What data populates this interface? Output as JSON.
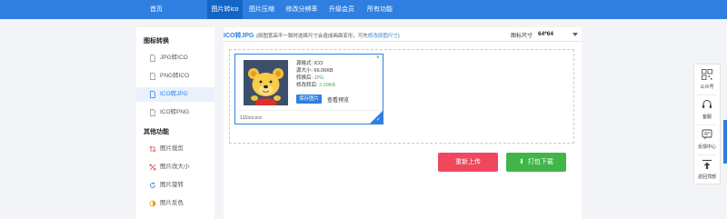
{
  "nav": {
    "items": [
      {
        "label": "首页",
        "active": false
      },
      {
        "label": "图片转ico",
        "active": true
      },
      {
        "label": "图片压缩",
        "active": false
      },
      {
        "label": "修改分辨率",
        "active": false
      },
      {
        "label": "升级会员",
        "active": false
      },
      {
        "label": "所有功能",
        "active": false
      }
    ]
  },
  "sidebar": {
    "group1": "图标转换",
    "items1": [
      {
        "label": "JPG转ICO",
        "icon": "file-icon"
      },
      {
        "label": "PNG转ICO",
        "icon": "file-icon"
      },
      {
        "label": "ICO转JPG",
        "icon": "file-icon"
      },
      {
        "label": "ICO转PNG",
        "icon": "file-icon"
      }
    ],
    "group2": "其他功能",
    "items2": [
      {
        "label": "图片裁剪",
        "icon": "crop-icon"
      },
      {
        "label": "图片改大小",
        "icon": "resize-icon"
      },
      {
        "label": "图片旋转",
        "icon": "rotate-icon"
      },
      {
        "label": "图片反色",
        "icon": "invert-icon"
      }
    ]
  },
  "main": {
    "title": "ICO转JPG",
    "note_prefix": "(原图宽高不一致时选择尺寸会造成画面变形，可先",
    "note_link": "修改原图尺寸",
    "note_suffix": ")",
    "size_label": "图标尺寸",
    "size_value": "64*64"
  },
  "card": {
    "format_label": "源格式: ICO",
    "size_label": "源大小: 66.06KB",
    "converted_prefix": "转换后: ",
    "converted_value": "JPG",
    "modified_prefix": "修改转后: ",
    "modified_value": "2.09KB",
    "save_label": "保存图片",
    "preview_label": "查看预览",
    "close": "×",
    "filename": "111ico.ico",
    "check": "✓"
  },
  "actions": {
    "reupload": "重新上传",
    "download": "打包下载",
    "download_icon": "⬇"
  },
  "floatbar": {
    "items": [
      {
        "label": "公众号",
        "icon": "qrcode-icon"
      },
      {
        "label": "客服",
        "icon": "headset-icon"
      },
      {
        "label": "反馈中心",
        "icon": "feedback-icon"
      },
      {
        "label": "返回顶部",
        "icon": "back-to-top-icon"
      }
    ]
  },
  "colors": {
    "primary": "#2f7fe0",
    "nav_active": "#1565c6",
    "danger": "#f0475f",
    "success": "#42b549"
  }
}
